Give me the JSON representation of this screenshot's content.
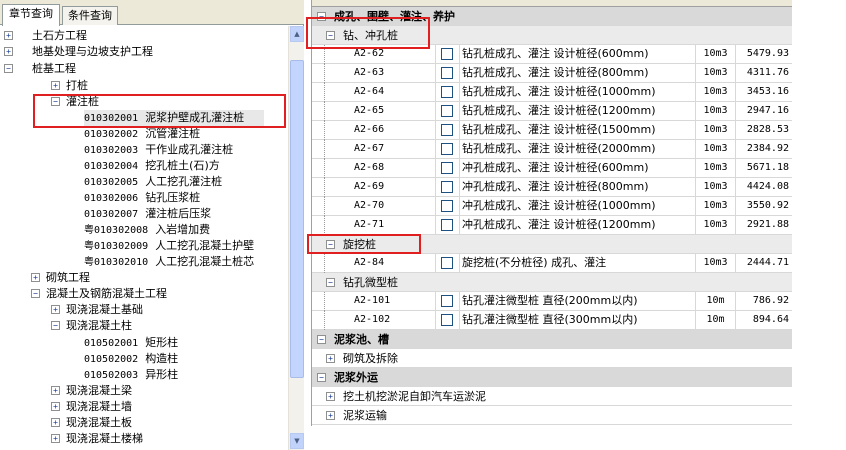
{
  "left": {
    "tabs": [
      "章节查询",
      "条件查询"
    ],
    "tree": [
      {
        "label": "土石方工程",
        "box": "+",
        "level": 0
      },
      {
        "label": "地基处理与边坡支护工程",
        "box": "+",
        "level": 0
      },
      {
        "label": "桩基工程",
        "box": "−",
        "level": 0
      },
      {
        "label": "打桩",
        "box": "+",
        "level": 1
      },
      {
        "label": "灌注桩",
        "box": "−",
        "level": 1
      },
      {
        "code": "010302001",
        "label": "泥浆护壁成孔灌注桩",
        "level": 2,
        "selected": true
      },
      {
        "code": "010302002",
        "label": "沉管灌注桩",
        "level": 2
      },
      {
        "code": "010302003",
        "label": "干作业成孔灌注桩",
        "level": 2
      },
      {
        "code": "010302004",
        "label": "挖孔桩土(石)方",
        "level": 2
      },
      {
        "code": "010302005",
        "label": "人工挖孔灌注桩",
        "level": 2
      },
      {
        "code": "010302006",
        "label": "钻孔压浆桩",
        "level": 2
      },
      {
        "code": "010302007",
        "label": "灌注桩后压浆",
        "level": 2
      },
      {
        "code": "粤010302008",
        "label": "入岩增加费",
        "level": 2
      },
      {
        "code": "粤010302009",
        "label": "人工挖孔混凝土护壁",
        "level": 2
      },
      {
        "code": "粤010302010",
        "label": "人工挖孔混凝土桩芯",
        "level": 2
      },
      {
        "label": "砌筑工程",
        "box": "+",
        "level": 0
      },
      {
        "label": "混凝土及钢筋混凝土工程",
        "box": "−",
        "level": 0
      },
      {
        "label": "现浇混凝土基础",
        "box": "+",
        "level": 1
      },
      {
        "label": "现浇混凝土柱",
        "box": "−",
        "level": 1
      },
      {
        "code": "010502001",
        "label": "矩形柱",
        "level": 2
      },
      {
        "code": "010502002",
        "label": "构造柱",
        "level": 2
      },
      {
        "code": "010502003",
        "label": "异形柱",
        "level": 2
      },
      {
        "label": "现浇混凝土梁",
        "box": "+",
        "level": 1
      },
      {
        "label": "现浇混凝土墙",
        "box": "+",
        "level": 1
      },
      {
        "label": "现浇混凝土板",
        "box": "+",
        "level": 1
      },
      {
        "label": "现浇混凝土楼梯",
        "box": "+",
        "level": 1
      }
    ]
  },
  "right": {
    "top_group": "成孔、围壁、灌注、养护",
    "sub1": "钻、冲孔桩",
    "rows1": [
      {
        "code": "A2-62",
        "name": "钻孔桩成孔、灌注 设计桩径(600mm)",
        "unit": "10m3",
        "price": "5479.93"
      },
      {
        "code": "A2-63",
        "name": "钻孔桩成孔、灌注 设计桩径(800mm)",
        "unit": "10m3",
        "price": "4311.76"
      },
      {
        "code": "A2-64",
        "name": "钻孔桩成孔、灌注 设计桩径(1000mm)",
        "unit": "10m3",
        "price": "3453.16"
      },
      {
        "code": "A2-65",
        "name": "钻孔桩成孔、灌注 设计桩径(1200mm)",
        "unit": "10m3",
        "price": "2947.16"
      },
      {
        "code": "A2-66",
        "name": "钻孔桩成孔、灌注 设计桩径(1500mm)",
        "unit": "10m3",
        "price": "2828.53"
      },
      {
        "code": "A2-67",
        "name": "钻孔桩成孔、灌注 设计桩径(2000mm)",
        "unit": "10m3",
        "price": "2384.92"
      },
      {
        "code": "A2-68",
        "name": "冲孔桩成孔、灌注 设计桩径(600mm)",
        "unit": "10m3",
        "price": "5671.18"
      },
      {
        "code": "A2-69",
        "name": "冲孔桩成孔、灌注 设计桩径(800mm)",
        "unit": "10m3",
        "price": "4424.08"
      },
      {
        "code": "A2-70",
        "name": "冲孔桩成孔、灌注 设计桩径(1000mm)",
        "unit": "10m3",
        "price": "3550.92"
      },
      {
        "code": "A2-71",
        "name": "冲孔桩成孔、灌注 设计桩径(1200mm)",
        "unit": "10m3",
        "price": "2921.88"
      }
    ],
    "sub2": "旋挖桩",
    "rows2": [
      {
        "code": "A2-84",
        "name": "旋挖桩(不分桩径) 成孔、灌注",
        "unit": "10m3",
        "price": "2444.71"
      }
    ],
    "sub3": "钻孔微型桩",
    "rows3": [
      {
        "code": "A2-101",
        "name": "钻孔灌注微型桩 直径(200mm以内)",
        "unit": "10m",
        "price": "786.92"
      },
      {
        "code": "A2-102",
        "name": "钻孔灌注微型桩 直径(300mm以内)",
        "unit": "10m",
        "price": "894.64"
      }
    ],
    "group2": "泥浆池、槽",
    "group2_child": "砌筑及拆除",
    "group3": "泥浆外运",
    "group3_children": [
      "挖土机挖淤泥自卸汽车运淤泥",
      "泥浆运输"
    ]
  }
}
